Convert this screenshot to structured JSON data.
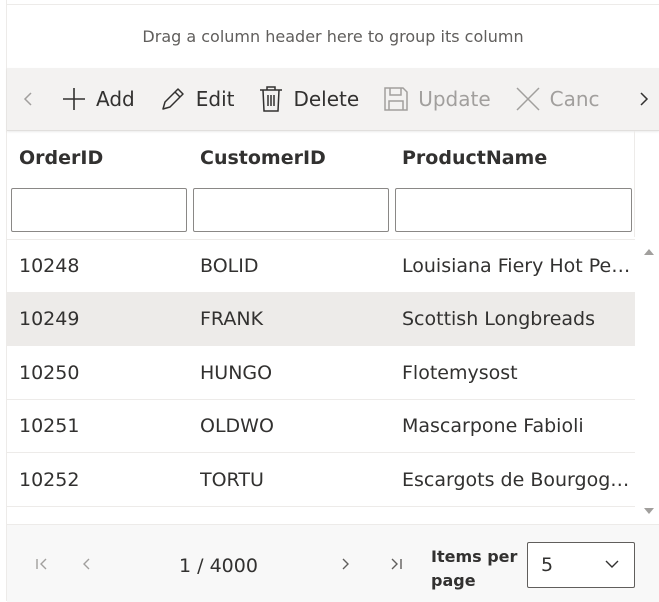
{
  "group_panel": {
    "text": "Drag a column header here to group its column"
  },
  "toolbar": {
    "buttons": [
      {
        "label": "Add",
        "icon": "plus-icon",
        "enabled": true
      },
      {
        "label": "Edit",
        "icon": "pencil-icon",
        "enabled": true
      },
      {
        "label": "Delete",
        "icon": "trash-icon",
        "enabled": true
      },
      {
        "label": "Update",
        "icon": "save-icon",
        "enabled": false
      },
      {
        "label": "Canc",
        "icon": "close-icon",
        "enabled": false
      }
    ]
  },
  "columns": [
    "OrderID",
    "CustomerID",
    "ProductName"
  ],
  "rows": [
    {
      "order_id": "10248",
      "customer_id": "BOLID",
      "product": "Louisiana Fiery Hot Pe…"
    },
    {
      "order_id": "10249",
      "customer_id": "FRANK",
      "product": "Scottish Longbreads"
    },
    {
      "order_id": "10250",
      "customer_id": "HUNGO",
      "product": "Flotemysost"
    },
    {
      "order_id": "10251",
      "customer_id": "OLDWO",
      "product": "Mascarpone Fabioli"
    },
    {
      "order_id": "10252",
      "customer_id": "TORTU",
      "product": "Escargots de Bourgog…"
    }
  ],
  "selected_row": 1,
  "pager": {
    "info": "1 / 4000",
    "items_per_page_label": "Items per page",
    "page_size": "5"
  },
  "colors": {
    "toolbar_bg": "#f3f2f1",
    "selected_row_bg": "#edebe9",
    "disabled": "#a19f9d"
  }
}
